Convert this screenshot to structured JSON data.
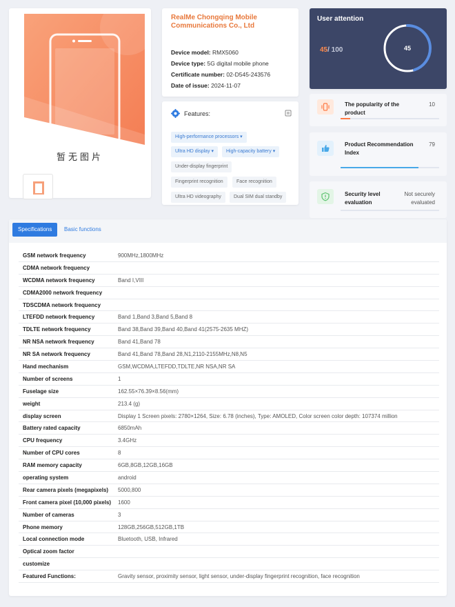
{
  "product_image": {
    "no_image_text": "暂无图片",
    "accent_color": "#f7926a"
  },
  "company": {
    "name": "RealMe Chongqing Mobile Communications Co., Ltd",
    "fields": [
      {
        "label": "Device model:",
        "value": "RMX5060"
      },
      {
        "label": "Device type:",
        "value": "5G digital mobile phone"
      },
      {
        "label": "Certificate number:",
        "value": "02-D545-243576"
      },
      {
        "label": "Date of issue:",
        "value": "2024-11-07"
      }
    ]
  },
  "features": {
    "title": "Features:",
    "tags": [
      "High-performance processors ▾",
      "Ultra HD display ▾",
      "High-capacity battery ▾",
      "Under-display fingerprint",
      "Fingerprint recognition",
      "Face recognition",
      "Ultra HD videography",
      "Dual SIM dual standby"
    ]
  },
  "attention": {
    "title": "User attention",
    "current": "45",
    "max": "/ 100",
    "gauge_value": "45",
    "gauge_fraction": 0.45
  },
  "metrics": {
    "popularity": {
      "label": "The popularity of the product",
      "value": "10",
      "fraction": 0.1,
      "color": "#ff7a45"
    },
    "recommendation": {
      "label": "Product Recommendation Index",
      "value": "79",
      "fraction": 0.79,
      "color": "#48a8e8"
    },
    "security": {
      "label": "Security level evaluation",
      "value": "Not securely evaluated",
      "fraction": 0,
      "color": "#5cc26f"
    }
  },
  "tabs": {
    "active": "Specifications",
    "inactive": "Basic functions"
  },
  "specs": [
    {
      "k": "GSM network frequency",
      "v": "900MHz,1800MHz"
    },
    {
      "k": "CDMA network frequency",
      "v": ""
    },
    {
      "k": "WCDMA network frequency",
      "v": "Band I,VIII"
    },
    {
      "k": "CDMA2000 network frequency",
      "v": ""
    },
    {
      "k": "TDSCDMA network frequency",
      "v": ""
    },
    {
      "k": "LTEFDD network frequency",
      "v": "Band 1,Band 3,Band 5,Band 8"
    },
    {
      "k": "TDLTE network frequency",
      "v": "Band 38,Band 39,Band 40,Band 41(2575-2635 MHZ)"
    },
    {
      "k": "NR NSA network frequency",
      "v": "Band 41,Band 78"
    },
    {
      "k": "NR SA network frequency",
      "v": "Band 41,Band 78,Band 28,N1,2110-2155MHz,N8,N5"
    },
    {
      "k": "Hand mechanism",
      "v": "GSM,WCDMA,LTEFDD,TDLTE,NR NSA,NR SA"
    },
    {
      "k": "Number of screens",
      "v": "1"
    },
    {
      "k": "Fuselage size",
      "v": "162.55×76.39×8.56(mm)"
    },
    {
      "k": "weight",
      "v": "213.4 (g)"
    },
    {
      "k": "display screen",
      "v": "Display 1 Screen pixels: 2780×1264, Size: 6.78 (inches), Type: AMOLED, Color screen color depth: 107374 million"
    },
    {
      "k": "Battery rated capacity",
      "v": "6850mAh"
    },
    {
      "k": "CPU frequency",
      "v": "3.4GHz"
    },
    {
      "k": "Number of CPU cores",
      "v": "8"
    },
    {
      "k": "RAM memory capacity",
      "v": "6GB,8GB,12GB,16GB"
    },
    {
      "k": "operating system",
      "v": "android"
    },
    {
      "k": "Rear camera pixels (megapixels)",
      "v": "5000,800"
    },
    {
      "k": "Front camera pixel (10,000 pixels)",
      "v": "1600"
    },
    {
      "k": "Number of cameras",
      "v": "3"
    },
    {
      "k": "Phone memory",
      "v": "128GB,256GB,512GB,1TB"
    },
    {
      "k": "Local connection mode",
      "v": "Bluetooth, USB, Infrared"
    },
    {
      "k": "Optical zoom factor",
      "v": ""
    },
    {
      "k": "customize",
      "v": ""
    },
    {
      "k": "Featured Functions:",
      "v": "Gravity sensor, proximity sensor, light sensor, under-display fingerprint recognition, face recognition"
    }
  ]
}
